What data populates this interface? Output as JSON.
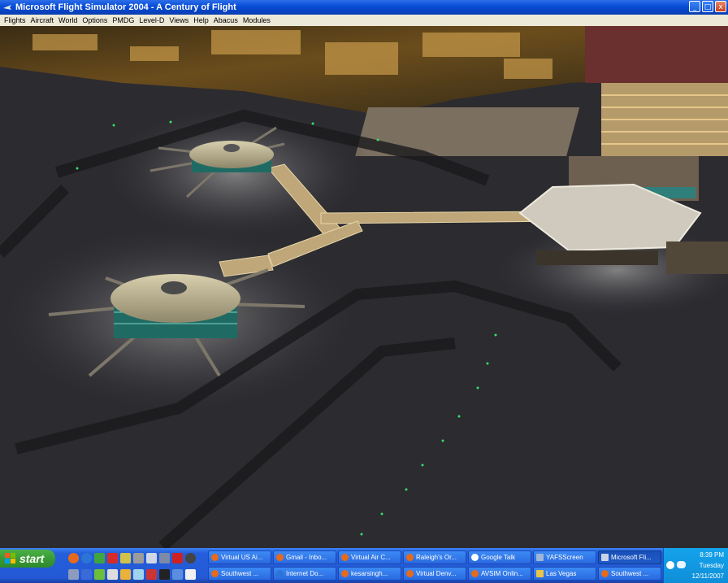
{
  "window": {
    "title": "Microsoft Flight Simulator 2004 - A Century of Flight",
    "controls": {
      "minimize": "_",
      "maximize": "□",
      "close": "x"
    }
  },
  "menu": [
    "Flights",
    "Aircraft",
    "World",
    "Options",
    "PMDG",
    "Level-D",
    "Views",
    "Help",
    "Abacus",
    "Modules"
  ],
  "taskbar": {
    "start_label": "start",
    "row1": [
      "Virtual US Ai...",
      "Gmail - Inbo...",
      "Virtual Air C...",
      "Raleigh's Or...",
      "Google Talk",
      "YAFSScreen",
      "Microsoft Fli..."
    ],
    "row2": [
      "Southwest ...",
      "Internet Do...",
      "kesarsingh...",
      "Virtual Denv...",
      "AVSIM Onlin...",
      "Las Vegas",
      "Southwest ..."
    ],
    "active_index": 6
  },
  "clock": {
    "time": "8:39 PM",
    "day": "Tuesday",
    "date": "12/11/2007"
  },
  "colors": {
    "titlebar": "#0a4fd9",
    "taskbar": "#245edb",
    "start": "#3a9a36",
    "tray": "#0f8ed8"
  }
}
